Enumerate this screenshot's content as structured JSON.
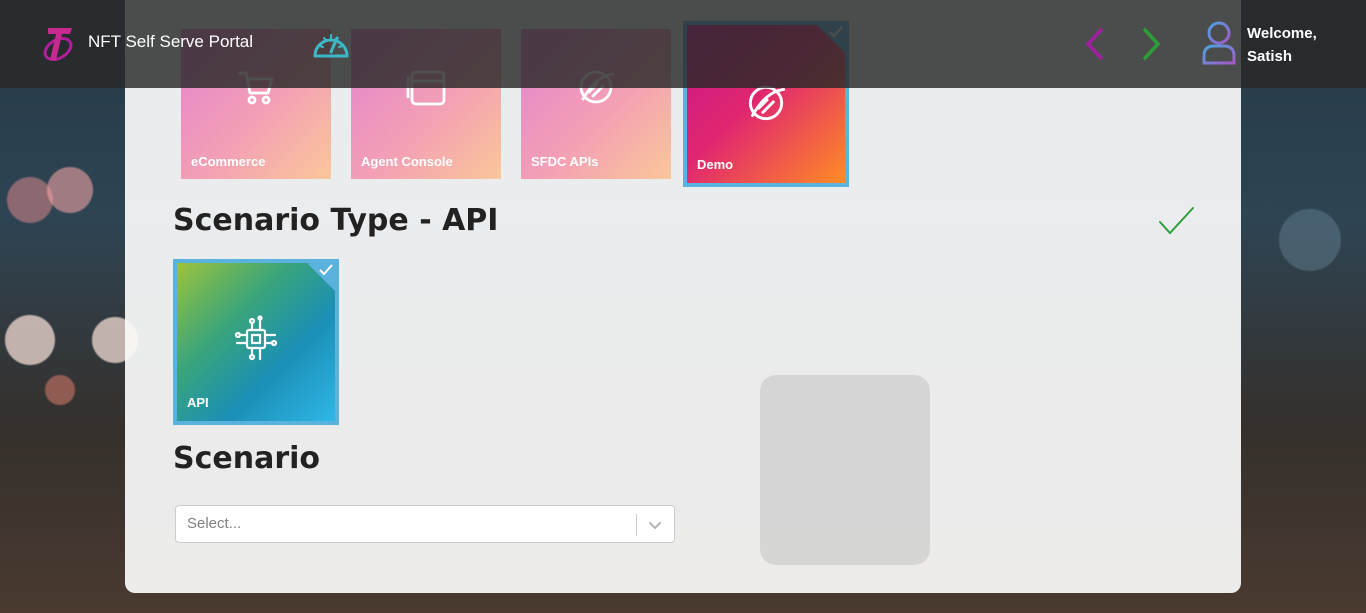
{
  "header": {
    "app_title": "NFT Self Serve Portal",
    "welcome_line1": "Welcome,",
    "welcome_line2": "Satish"
  },
  "applications": [
    {
      "label": "eCommerce",
      "icon": "cart-icon",
      "selected": false
    },
    {
      "label": "Agent Console",
      "icon": "window-icon",
      "selected": false
    },
    {
      "label": "SFDC APIs",
      "icon": "globe-link-icon",
      "selected": false
    },
    {
      "label": "Demo",
      "icon": "globe-link-icon",
      "selected": true
    }
  ],
  "scenario_type": {
    "title": "Scenario Type - API",
    "completed": true,
    "tiles": [
      {
        "label": "API",
        "icon": "circuit-chip-icon",
        "selected": true
      }
    ]
  },
  "scenario": {
    "title": "Scenario",
    "select_placeholder": "Select..."
  },
  "colors": {
    "selection_border": "#5ab2df",
    "check_green": "#2e9e3a",
    "prev_arrow": "#a020a0",
    "next_arrow": "#2e9e3a"
  }
}
